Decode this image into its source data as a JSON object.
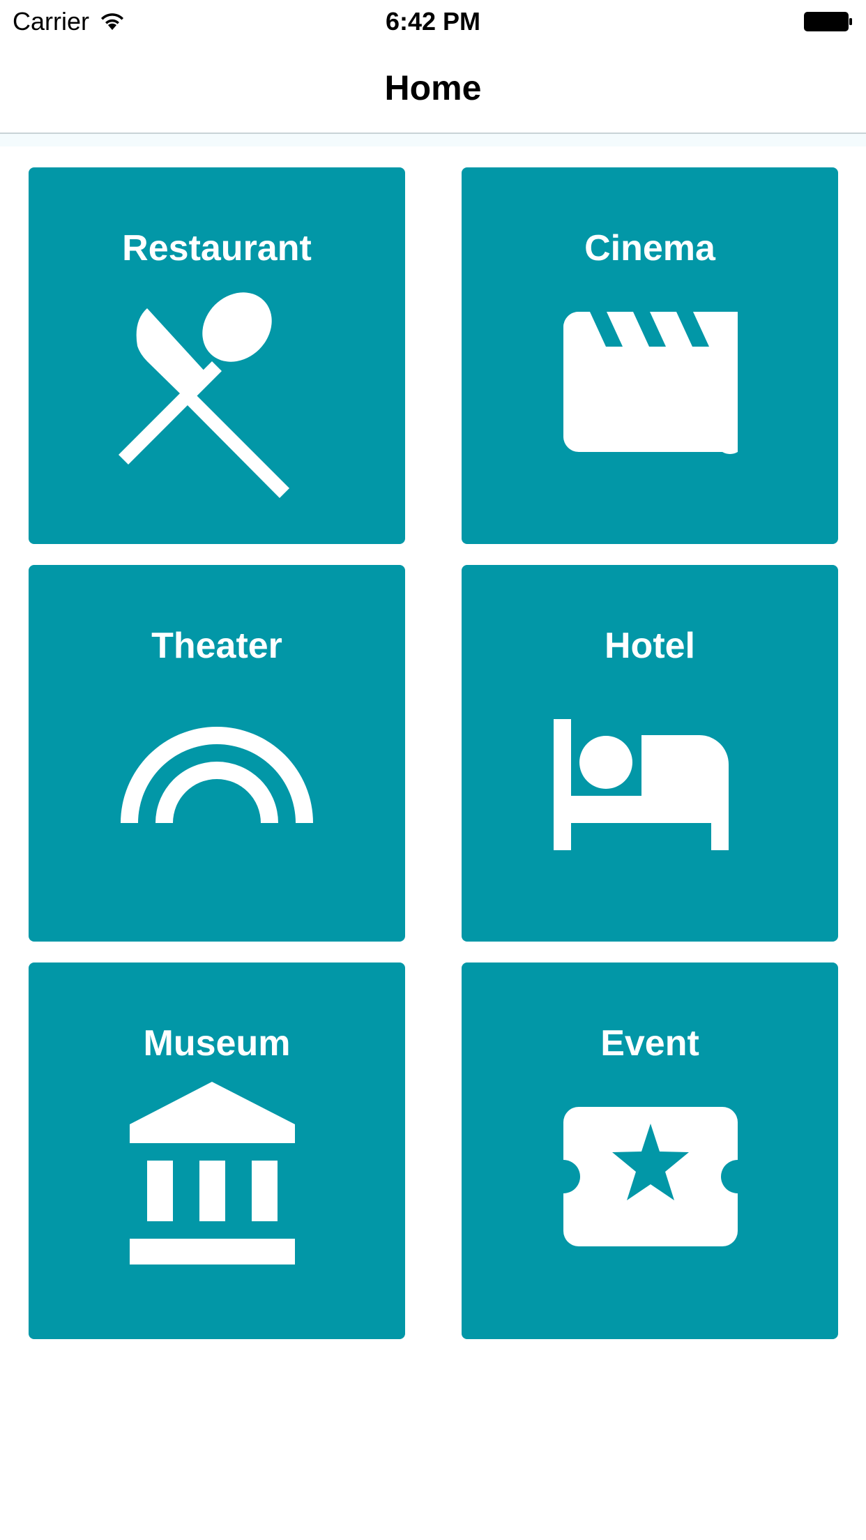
{
  "status_bar": {
    "carrier": "Carrier",
    "time": "6:42 PM"
  },
  "nav": {
    "title": "Home"
  },
  "tiles": [
    {
      "label": "Restaurant",
      "icon": "restaurant-icon"
    },
    {
      "label": "Cinema",
      "icon": "movie-clapper-icon"
    },
    {
      "label": "Theater",
      "icon": "rainbow-icon"
    },
    {
      "label": "Hotel",
      "icon": "bed-icon"
    },
    {
      "label": "Museum",
      "icon": "museum-icon"
    },
    {
      "label": "Event",
      "icon": "ticket-star-icon"
    }
  ],
  "colors": {
    "tile_background": "#0297a7",
    "tile_foreground": "#ffffff",
    "nav_divider": "#c8d3d6"
  }
}
